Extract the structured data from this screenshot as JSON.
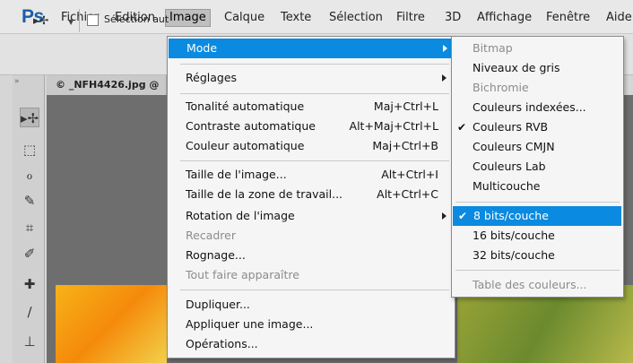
{
  "app": {
    "logo": "Ps"
  },
  "menubar": {
    "items": [
      {
        "label": "Fichier"
      },
      {
        "label": "Edition"
      },
      {
        "label": "Image"
      },
      {
        "label": "Calque"
      },
      {
        "label": "Texte"
      },
      {
        "label": "Sélection"
      },
      {
        "label": "Filtre"
      },
      {
        "label": "3D"
      },
      {
        "label": "Affichage"
      },
      {
        "label": "Fenêtre"
      },
      {
        "label": "Aide"
      }
    ]
  },
  "options_bar": {
    "auto_select_label": "Sélection aut"
  },
  "document": {
    "tab_title": "© _NFH4426.jpg @"
  },
  "image_menu": {
    "items": [
      {
        "label": "Mode",
        "shortcut": ""
      },
      {
        "label": "Réglages",
        "shortcut": ""
      },
      {
        "label": "Tonalité automatique",
        "shortcut": "Maj+Ctrl+L"
      },
      {
        "label": "Contraste automatique",
        "shortcut": "Alt+Maj+Ctrl+L"
      },
      {
        "label": "Couleur automatique",
        "shortcut": "Maj+Ctrl+B"
      },
      {
        "label": "Taille de l'image...",
        "shortcut": "Alt+Ctrl+I"
      },
      {
        "label": "Taille de la zone de travail...",
        "shortcut": "Alt+Ctrl+C"
      },
      {
        "label": "Rotation de l'image",
        "shortcut": ""
      },
      {
        "label": "Recadrer",
        "shortcut": ""
      },
      {
        "label": "Rognage...",
        "shortcut": ""
      },
      {
        "label": "Tout faire apparaître",
        "shortcut": ""
      },
      {
        "label": "Dupliquer...",
        "shortcut": ""
      },
      {
        "label": "Appliquer une image...",
        "shortcut": ""
      },
      {
        "label": "Opérations...",
        "shortcut": ""
      }
    ]
  },
  "mode_submenu": {
    "items": [
      {
        "label": "Bitmap"
      },
      {
        "label": "Niveaux de gris"
      },
      {
        "label": "Bichromie"
      },
      {
        "label": "Couleurs indexées..."
      },
      {
        "label": "Couleurs RVB"
      },
      {
        "label": "Couleurs CMJN"
      },
      {
        "label": "Couleurs Lab"
      },
      {
        "label": "Multicouche"
      },
      {
        "label": "8 bits/couche"
      },
      {
        "label": "16 bits/couche"
      },
      {
        "label": "32 bits/couche"
      },
      {
        "label": "Table des couleurs..."
      }
    ],
    "checkmark": "✔"
  },
  "colors": {
    "highlight": "#0a8ae0",
    "logo": "#1a5ea8"
  }
}
